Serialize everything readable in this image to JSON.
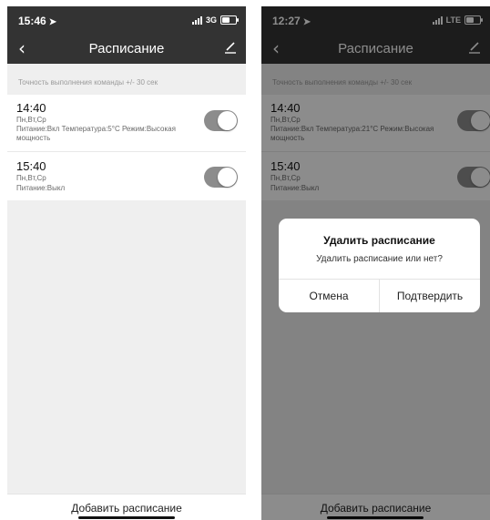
{
  "left": {
    "status": {
      "time": "15:46",
      "network": "3G"
    },
    "nav": {
      "title": "Расписание"
    },
    "hint": "Точность выполнения команды +/- 30 сек",
    "schedules": [
      {
        "time": "14:40",
        "days": "Пн,Вт,Ср",
        "details": "Питание:Вкл  Температура:5°C  Режим:Высокая мощность",
        "enabled": true
      },
      {
        "time": "15:40",
        "days": "Пн,Вт,Ср",
        "details": "Питание:Выкл",
        "enabled": true
      }
    ],
    "add_button": "Добавить расписание"
  },
  "right": {
    "status": {
      "time": "12:27",
      "network": "LTE"
    },
    "nav": {
      "title": "Расписание"
    },
    "hint": "Точность выполнения команды +/- 30 сек",
    "schedules": [
      {
        "time": "14:40",
        "days": "Пн,Вт,Ср",
        "details": "Питание:Вкл  Температура:21°C  Режим:Высокая мощность",
        "enabled": true
      },
      {
        "time": "15:40",
        "days": "Пн,Вт,Ср",
        "details": "Питание:Выкл",
        "enabled": true
      }
    ],
    "add_button": "Добавить расписание",
    "dialog": {
      "title": "Удалить расписание",
      "message": "Удалить расписание или нет?",
      "cancel": "Отмена",
      "confirm": "Подтвердить"
    }
  },
  "colors": {
    "bar": "#333333",
    "toggle_on": "#8c8c8c",
    "background": "#efefef"
  },
  "icons": {
    "back": "chevron-left-icon",
    "edit": "pencil-icon",
    "location": "location-arrow-icon"
  }
}
